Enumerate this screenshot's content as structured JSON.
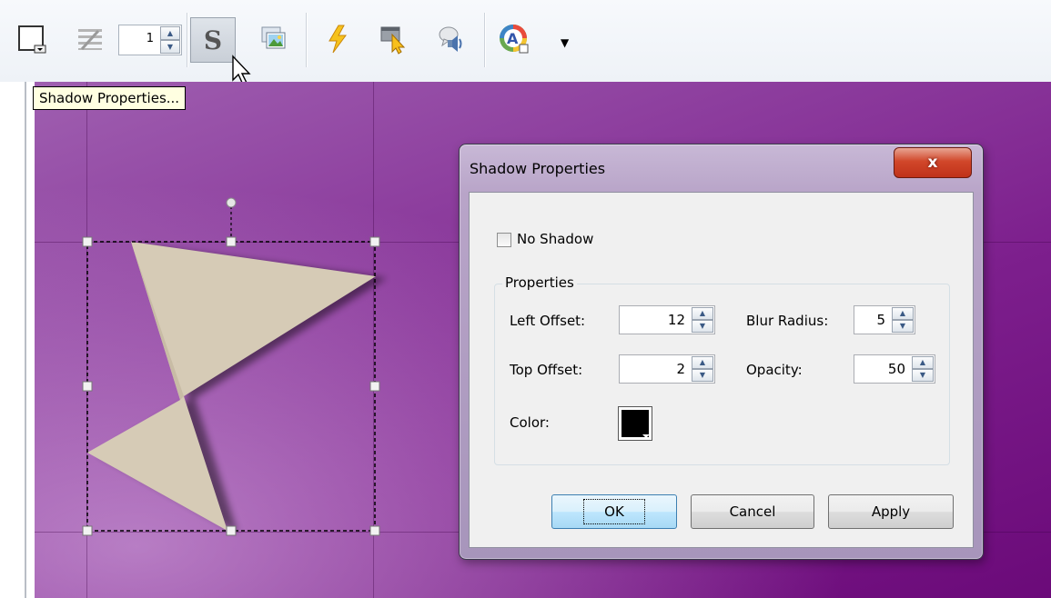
{
  "toolbar": {
    "line_width_value": "1",
    "buttons": [
      "shape-outline",
      "line-style",
      "shadow",
      "picture",
      "lightning",
      "pointer",
      "sound",
      "color"
    ]
  },
  "tooltip": {
    "text": "Shadow Properties..."
  },
  "dialog": {
    "title": "Shadow Properties",
    "close_glyph": "x",
    "no_shadow_label": "No Shadow",
    "no_shadow_checked": false,
    "group_title": "Properties",
    "left_offset_label": "Left Offset:",
    "left_offset_value": "12",
    "top_offset_label": "Top Offset:",
    "top_offset_value": "2",
    "blur_radius_label": "Blur Radius:",
    "blur_radius_value": "5",
    "opacity_label": "Opacity:",
    "opacity_value": "50",
    "color_label": "Color:",
    "color_value": "#000000",
    "ok_label": "OK",
    "cancel_label": "Cancel",
    "apply_label": "Apply"
  },
  "colors": {
    "canvas_purple": "#7d1f8d",
    "shape_fill": "#d6cbb6",
    "shadow": "#000000",
    "close_red": "#c0321a"
  }
}
